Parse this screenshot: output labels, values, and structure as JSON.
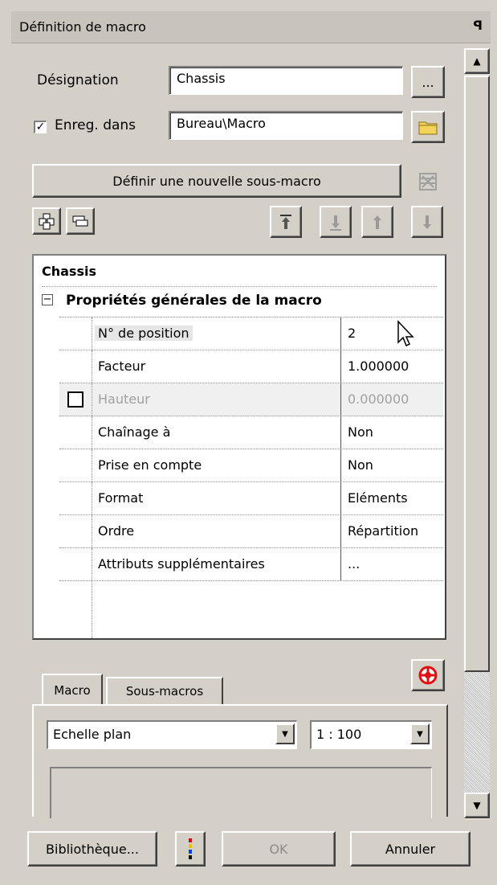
{
  "window": {
    "title": "Définition de macro",
    "pin_glyph": "ꟼ"
  },
  "designation": {
    "label": "Désignation",
    "value": "Chassis",
    "browse_label": "..."
  },
  "save_in": {
    "label": "Enreg. dans",
    "checked": true,
    "value": "Bureau\\Macro",
    "folder_icon": "folder-icon"
  },
  "define_button": {
    "label": "Définir une nouvelle sous-macro"
  },
  "toolbar": {
    "icons": [
      "add-item-icon",
      "edit-item-icon",
      "move-top-icon",
      "move-down-icon",
      "move-up-icon",
      "move-bottom-icon"
    ]
  },
  "properties": {
    "root_label": "Chassis",
    "group_toggle": "−",
    "group_label": "Propriétés générales de la macro",
    "rows": [
      {
        "name": "N° de position",
        "value": "2",
        "enabled": true
      },
      {
        "name": "Facteur",
        "value": "1.000000",
        "enabled": true
      },
      {
        "name": "Hauteur",
        "value": "0.000000",
        "enabled": false
      },
      {
        "name": "Chaînage à",
        "value": "Non",
        "enabled": true
      },
      {
        "name": "Prise en compte",
        "value": "Non",
        "enabled": true
      },
      {
        "name": "Format",
        "value": "Eléments",
        "enabled": true
      },
      {
        "name": "Ordre",
        "value": "Répartition",
        "enabled": true
      },
      {
        "name": "Attributs supplémentaires",
        "value": "...",
        "enabled": true
      }
    ]
  },
  "tabs": {
    "items": [
      "Macro",
      "Sous-macros"
    ],
    "active": "Macro"
  },
  "scale": {
    "mode": "Echelle plan",
    "ratio": "1 : 100"
  },
  "footer": {
    "library_label": "Bibliothèque...",
    "ok_label": "OK",
    "cancel_label": "Annuler"
  }
}
